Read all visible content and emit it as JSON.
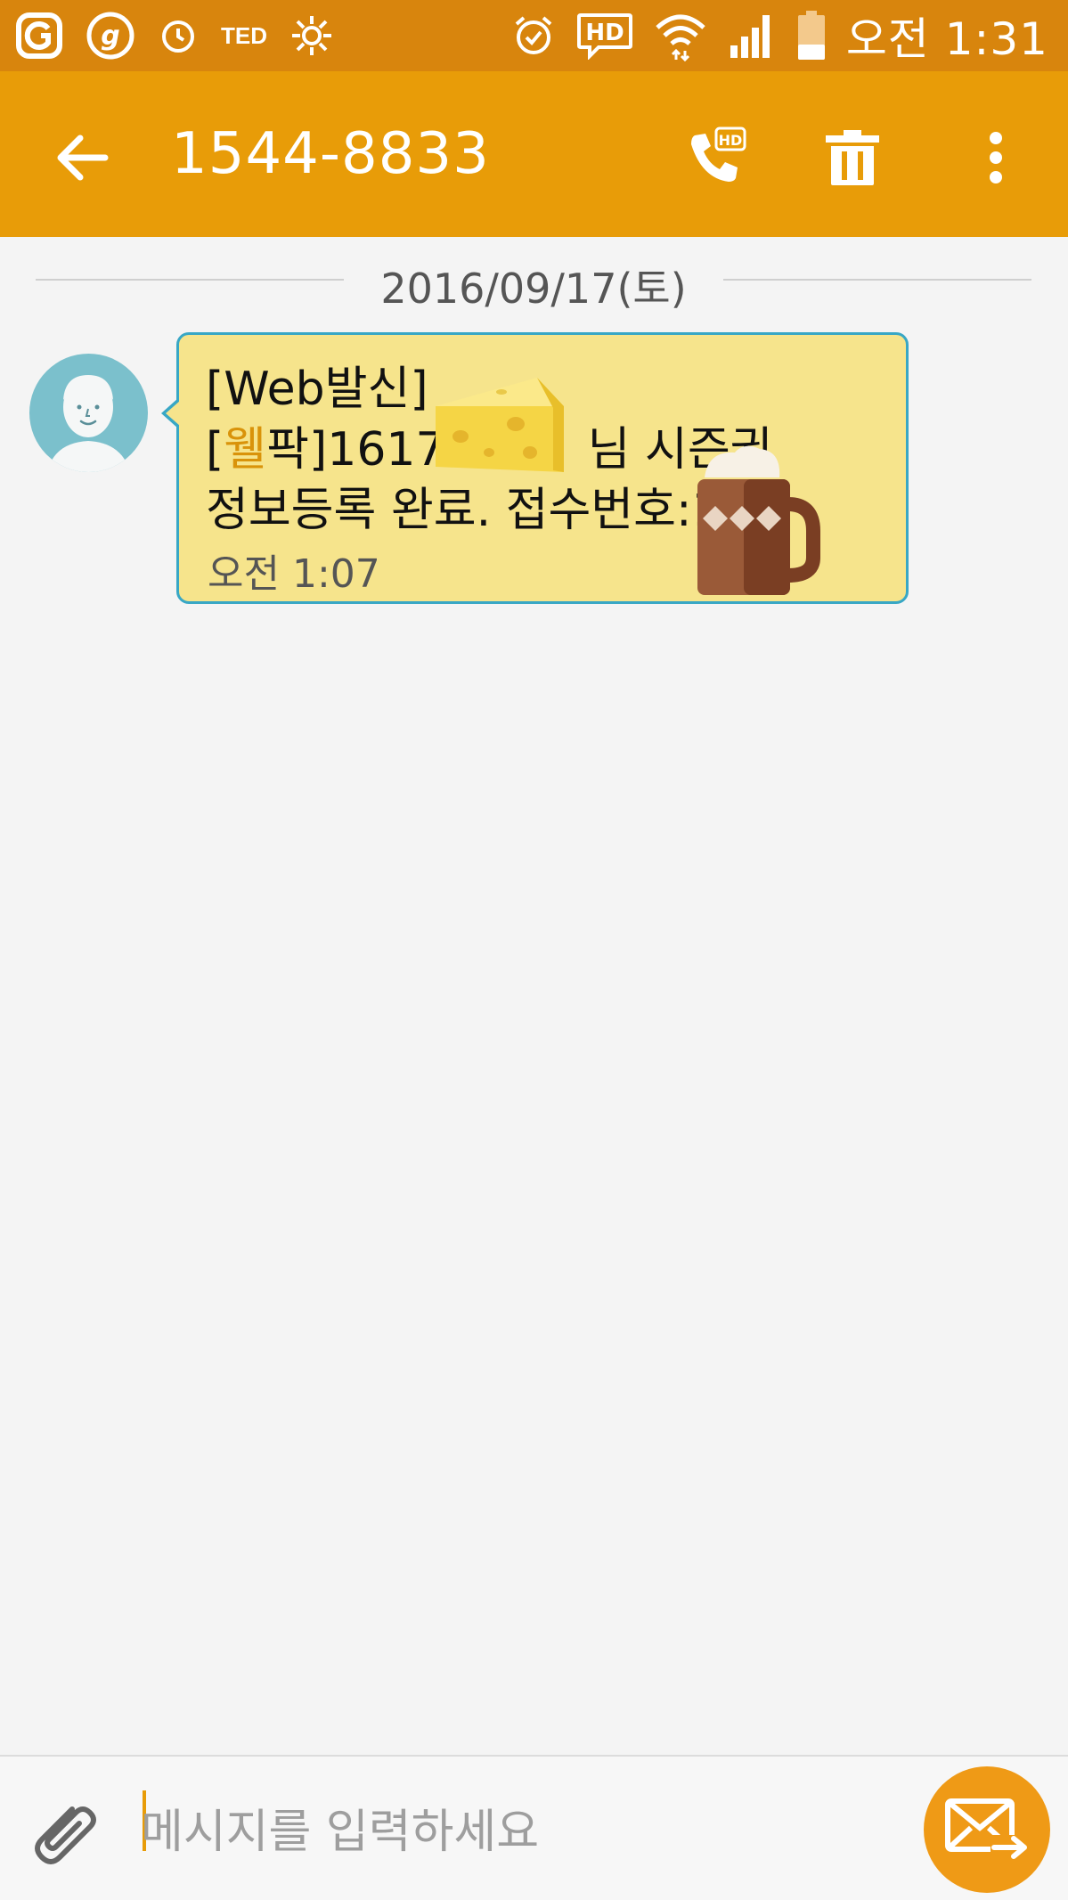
{
  "status_bar": {
    "time": "오전 1:31",
    "left_icons": [
      "g-logo-icon",
      "g-circle-icon",
      "alarm-clock-icon",
      "ted-icon",
      "sun-icon"
    ],
    "right_icons": [
      "alarm-icon",
      "hd-voice-icon",
      "wifi-icon",
      "signal-icon",
      "battery-icon"
    ],
    "ted_label": "TED",
    "hd_label": "HD"
  },
  "app_bar": {
    "title": "1544-8833",
    "back_icon": "arrow-left-icon",
    "actions": [
      "hd-call-icon",
      "trash-icon",
      "more-vertical-icon"
    ],
    "hd_call_label": "HD"
  },
  "conversation": {
    "date": "2016/09/17(토)",
    "messages": [
      {
        "line1": "[Web발신]",
        "line2_prefix": "[",
        "line2_accent": "웰",
        "line2_rest": "팍]1617",
        "line2_suffix": "님 시즌권",
        "line3": "정보등록 완료. 접수번호:1",
        "time": "오전 1:07",
        "stickers": [
          "cheese-sticker",
          "mug-sticker"
        ]
      }
    ]
  },
  "composer": {
    "placeholder": "메시지를 입력하세요",
    "attach_icon": "paperclip-icon",
    "send_icon": "send-mail-icon"
  },
  "colors": {
    "status_bar": "#d8850d",
    "app_bar": "#e89c08",
    "bubble": "#f6e48c",
    "bubble_border": "#38a7c5",
    "send_button": "#ef9a16"
  }
}
